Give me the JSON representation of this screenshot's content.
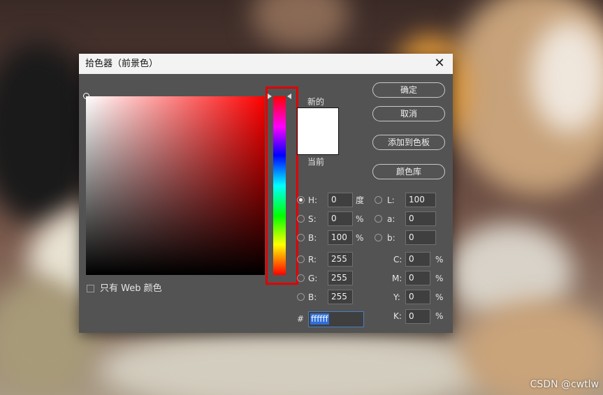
{
  "dialog": {
    "title": "拾色器（前景色）",
    "close_glyph": "✕"
  },
  "preview": {
    "new_label": "新的",
    "current_label": "当前",
    "new_color": "#ffffff",
    "current_color": "#ffffff"
  },
  "buttons": {
    "ok": "确定",
    "cancel": "取消",
    "add_to_swatches": "添加到色板",
    "color_libraries": "颜色库"
  },
  "hsb": {
    "h_label": "H:",
    "h_value": "0",
    "h_unit": "度",
    "s_label": "S:",
    "s_value": "0",
    "s_unit": "%",
    "b_label": "B:",
    "b_value": "100",
    "b_unit": "%",
    "selected": "H"
  },
  "lab": {
    "l_label": "L:",
    "l_value": "100",
    "a_label": "a:",
    "a_value": "0",
    "b_label": "b:",
    "b_value": "0"
  },
  "rgb": {
    "r_label": "R:",
    "r_value": "255",
    "g_label": "G:",
    "g_value": "255",
    "b_label": "B:",
    "b_value": "255"
  },
  "cmyk": {
    "c_label": "C:",
    "c_value": "0",
    "m_label": "M:",
    "m_value": "0",
    "y_label": "Y:",
    "y_value": "0",
    "k_label": "K:",
    "k_value": "0",
    "unit": "%"
  },
  "hex": {
    "hash": "#",
    "value": "ffffff"
  },
  "web_only": {
    "label": "只有 Web 颜色",
    "checked": false
  },
  "colors": {
    "highlight_box": "#e00000",
    "dialog_bg": "#535353",
    "hue": "#ff0000"
  },
  "watermark": "CSDN @cwtlw"
}
